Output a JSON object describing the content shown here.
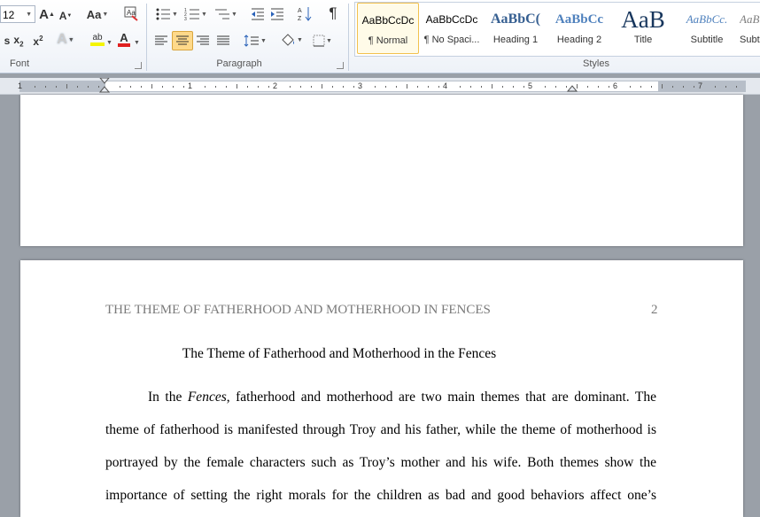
{
  "ribbon": {
    "font_group": {
      "label": "Font",
      "font_size": "12",
      "grow_font": "A",
      "shrink_font": "A",
      "change_case": "Aa",
      "subscript": "x",
      "subscript_mark": "2",
      "superscript": "x",
      "superscript_mark": "2",
      "text_effects": "A",
      "highlight": "ab",
      "font_color": "A"
    },
    "paragraph_group": {
      "label": "Paragraph",
      "pilcrow": "¶"
    },
    "styles_group": {
      "label": "Styles",
      "items": [
        {
          "sample": "AaBbCcDc",
          "name": "¶ Normal"
        },
        {
          "sample": "AaBbCcDc",
          "name": "¶ No Spaci..."
        },
        {
          "sample": "AaBbC(",
          "name": "Heading 1"
        },
        {
          "sample": "AaBbCc",
          "name": "Heading 2"
        },
        {
          "sample": "AaB",
          "name": "Title"
        },
        {
          "sample": "AaBbCc.",
          "name": "Subtitle"
        },
        {
          "sample": "AaBbC",
          "name": "Subt"
        }
      ]
    },
    "colors": {
      "accent": "#f2c14e",
      "font_color": "#e02020",
      "highlight": "#f4f400"
    }
  },
  "ruler": {
    "numbers": [
      "1",
      "1",
      "2",
      "3",
      "4",
      "5",
      "6",
      "7"
    ]
  },
  "document": {
    "running_header": "THE THEME OF FATHERHOOD AND MOTHERHOOD IN FENCES",
    "page_number": "2",
    "title": "The Theme of Fatherhood and Motherhood in the Fences",
    "para1_line1_prefix": "In the ",
    "para1_line1_italic": "Fences",
    "para1_line1_suffix": ", fatherhood and motherhood are two main themes that are dominant. The",
    "para1_line2": "theme of fatherhood is manifested through Troy and his father, while the theme of motherhood is",
    "para1_line3": "portrayed by the female characters such as Troy’s mother and his wife. Both themes show the",
    "para1_line4": "importance of setting the right morals for the children as bad and good behaviors affect one’s"
  }
}
